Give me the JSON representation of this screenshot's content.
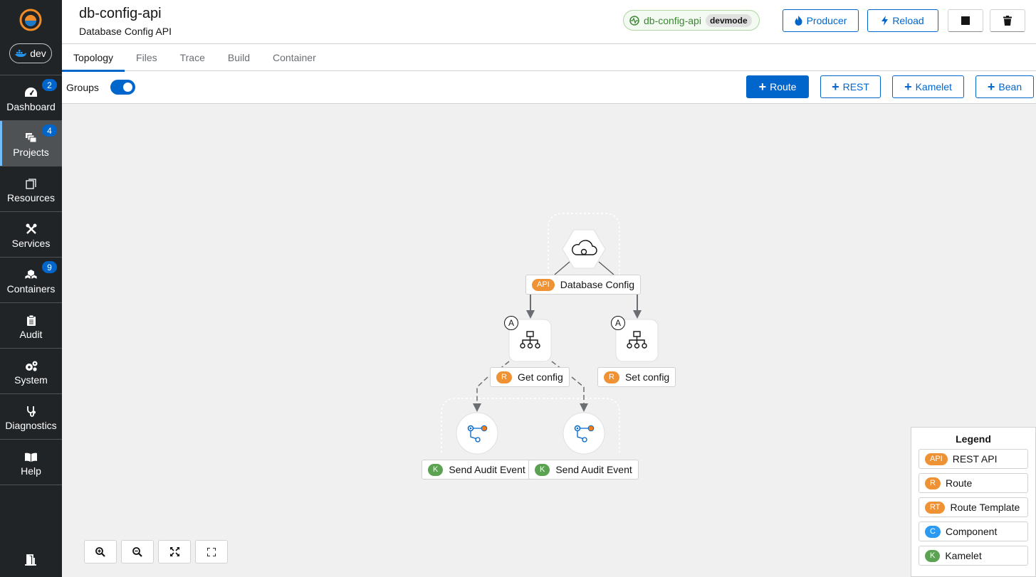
{
  "sidebar": {
    "env_label": "dev",
    "items": [
      {
        "label": "Dashboard",
        "badge": "2",
        "icon": "dashboard-icon"
      },
      {
        "label": "Projects",
        "badge": "4",
        "icon": "projects-icon",
        "active": true
      },
      {
        "label": "Resources",
        "badge": "",
        "icon": "resources-icon"
      },
      {
        "label": "Services",
        "badge": "",
        "icon": "services-icon"
      },
      {
        "label": "Containers",
        "badge": "9",
        "icon": "containers-icon"
      },
      {
        "label": "Audit",
        "badge": "",
        "icon": "audit-icon"
      },
      {
        "label": "System",
        "badge": "",
        "icon": "system-icon"
      },
      {
        "label": "Diagnostics",
        "badge": "",
        "icon": "diagnostics-icon"
      },
      {
        "label": "Help",
        "badge": "",
        "icon": "help-icon"
      }
    ]
  },
  "header": {
    "title": "db-config-api",
    "subtitle": "Database Config API",
    "status_name": "db-config-api",
    "status_mode": "devmode",
    "producer_label": "Producer",
    "reload_label": "Reload"
  },
  "tabs": [
    "Topology",
    "Files",
    "Trace",
    "Build",
    "Container"
  ],
  "toolbar": {
    "groups_label": "Groups",
    "route_label": "Route",
    "rest_label": "REST",
    "kamelet_label": "Kamelet",
    "bean_label": "Bean"
  },
  "topology": {
    "api_node": {
      "badge": "API",
      "label": "Database Config"
    },
    "route_get": {
      "badge": "R",
      "label": "Get config",
      "marker": "A"
    },
    "route_set": {
      "badge": "R",
      "label": "Set config",
      "marker": "A"
    },
    "kamelet_1": {
      "badge": "K",
      "label": "Send Audit Event"
    },
    "kamelet_2": {
      "badge": "K",
      "label": "Send Audit Event"
    }
  },
  "legend": {
    "title": "Legend",
    "items": [
      {
        "badge": "API",
        "label": "REST API",
        "color": "#ef9234"
      },
      {
        "badge": "R",
        "label": "Route",
        "color": "#ef9234"
      },
      {
        "badge": "RT",
        "label": "Route Template",
        "color": "#ef9234"
      },
      {
        "badge": "C",
        "label": "Component",
        "color": "#2b9af3"
      },
      {
        "badge": "K",
        "label": "Kamelet",
        "color": "#5ba352"
      }
    ]
  },
  "colors": {
    "accent": "#0066cc",
    "sidebar_bg": "#212427",
    "status_green": "#3e8635",
    "route_orange": "#ef9234",
    "kamelet_green": "#5ba352"
  }
}
